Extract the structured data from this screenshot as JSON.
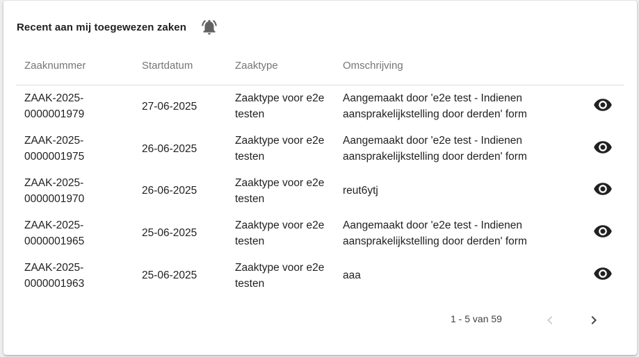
{
  "card": {
    "title": "Recent aan mij toegewezen zaken",
    "title_icon": "alarm-bell-icon"
  },
  "table": {
    "headers": [
      "Zaaknummer",
      "Startdatum",
      "Zaaktype",
      "Omschrijving"
    ],
    "rows": [
      {
        "zaaknummer_line1": "ZAAK-2025-",
        "zaaknummer_line2": "0000001979",
        "startdatum": "27-06-2025",
        "zaaktype_line1": "Zaaktype voor e2e",
        "zaaktype_line2": "testen",
        "omschrijving_line1": "Aangemaakt door 'e2e test - Indienen",
        "omschrijving_line2": "aansprakelijkstelling door derden' form",
        "action_icon": "eye-icon"
      },
      {
        "zaaknummer_line1": "ZAAK-2025-",
        "zaaknummer_line2": "0000001975",
        "startdatum": "26-06-2025",
        "zaaktype_line1": "Zaaktype voor e2e",
        "zaaktype_line2": "testen",
        "omschrijving_line1": "Aangemaakt door 'e2e test - Indienen",
        "omschrijving_line2": "aansprakelijkstelling door derden' form",
        "action_icon": "eye-icon"
      },
      {
        "zaaknummer_line1": "ZAAK-2025-",
        "zaaknummer_line2": "0000001970",
        "startdatum": "26-06-2025",
        "zaaktype_line1": "Zaaktype voor e2e",
        "zaaktype_line2": "testen",
        "omschrijving_line1": "reut6ytj",
        "omschrijving_line2": "",
        "action_icon": "eye-icon"
      },
      {
        "zaaknummer_line1": "ZAAK-2025-",
        "zaaknummer_line2": "0000001965",
        "startdatum": "25-06-2025",
        "zaaktype_line1": "Zaaktype voor e2e",
        "zaaktype_line2": "testen",
        "omschrijving_line1": "Aangemaakt door 'e2e test - Indienen",
        "omschrijving_line2": "aansprakelijkstelling door derden' form",
        "action_icon": "eye-icon"
      },
      {
        "zaaknummer_line1": "ZAAK-2025-",
        "zaaknummer_line2": "0000001963",
        "startdatum": "25-06-2025",
        "zaaktype_line1": "Zaaktype voor e2e",
        "zaaktype_line2": "testen",
        "omschrijving_line1": "aaa",
        "omschrijving_line2": "",
        "action_icon": "eye-icon"
      }
    ]
  },
  "paginator": {
    "range_label": "1 - 5 van 59",
    "prev_icon": "chevron-left-icon",
    "next_icon": "chevron-right-icon",
    "prev_enabled": false,
    "next_enabled": true
  },
  "colors": {
    "text": "#212121",
    "header_text": "#757575",
    "icon": "#212121",
    "icon_disabled": "#cfcfcf",
    "divider": "#dcdcdc"
  }
}
